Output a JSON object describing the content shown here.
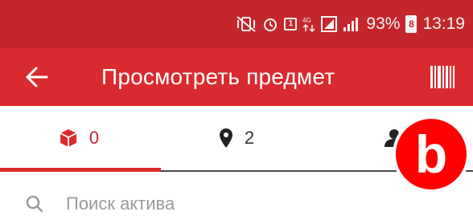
{
  "status_bar": {
    "sim_label": "1",
    "network": "4G",
    "battery": "93%",
    "battery_glyph": "8",
    "time": "13:19",
    "icons": [
      "mute-vibrate-icon",
      "alarm-icon",
      "sim-icon",
      "data-icon",
      "signal-icon",
      "battery-icon"
    ]
  },
  "app_bar": {
    "title": "Просмотреть предмет",
    "back_icon": "arrow-left-icon",
    "barcode_icon": "barcode-icon"
  },
  "tabs": [
    {
      "icon": "cube-icon",
      "count": "0",
      "active": true
    },
    {
      "icon": "map-marker-icon",
      "count": "2",
      "active": false
    },
    {
      "icon": "user-icon",
      "count": "",
      "active": false
    }
  ],
  "overlay_badge": {
    "label": "b"
  },
  "search": {
    "placeholder": "Поиск актива",
    "value": ""
  },
  "colors": {
    "status_bar": "#c4262b",
    "app_bar": "#d92b2f",
    "accent": "#d92b2f",
    "badge": "#ff0000"
  }
}
